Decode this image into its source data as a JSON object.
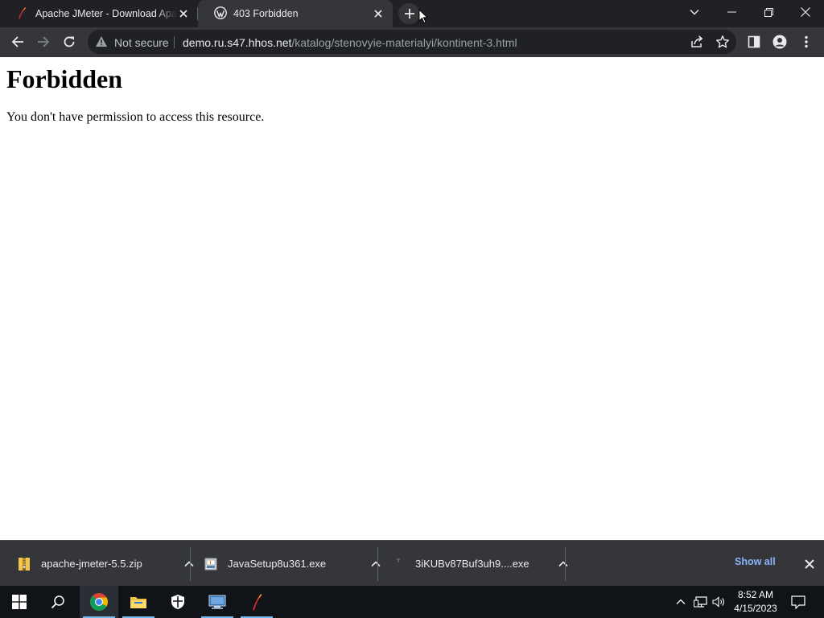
{
  "browser": {
    "tabs": [
      {
        "title": "Apache JMeter - Download Apache JMeter",
        "icon": "jmeter-feather-icon",
        "active": false
      },
      {
        "title": "403 Forbidden",
        "icon": "wordpress-icon",
        "active": true
      }
    ],
    "address_bar": {
      "security_label": "Not secure",
      "host": "demo.ru.s47.hhos.net",
      "path": "/katalog/stenovyie-materialyi/kontinent-3.html"
    }
  },
  "page": {
    "heading": "Forbidden",
    "message": "You don't have permission to access this resource."
  },
  "downloads": {
    "items": [
      {
        "filename": "apache-jmeter-5.5.zip",
        "icon": "zip-file-icon"
      },
      {
        "filename": "JavaSetup8u361.exe",
        "icon": "java-installer-icon"
      },
      {
        "filename": "3iKUBv87Buf3uh9....exe",
        "icon": "exe-file-icon"
      }
    ],
    "show_all_label": "Show all"
  },
  "taskbar": {
    "clock": {
      "time": "8:52 AM",
      "date": "4/15/2023"
    }
  },
  "colors": {
    "tab_strip": "#202124",
    "toolbar": "#35363a",
    "link_blue": "#8ab4f8",
    "taskbar": "#101318",
    "taskbar_active_indicator": "#76b9ed"
  }
}
